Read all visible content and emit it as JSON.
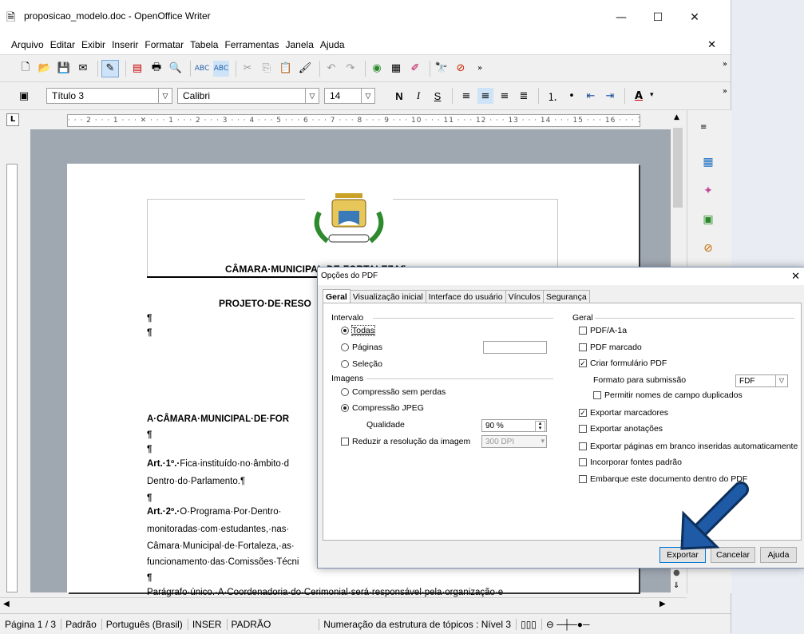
{
  "window": {
    "title": "proposicao_modelo.doc - OpenOffice Writer",
    "controls": [
      "—",
      "☐",
      "✕"
    ]
  },
  "menu": [
    "Arquivo",
    "Editar",
    "Exibir",
    "Inserir",
    "Formatar",
    "Tabela",
    "Ferramentas",
    "Janela",
    "Ajuda"
  ],
  "format_toolbar": {
    "style": "Título 3",
    "font": "Calibri",
    "size": "14",
    "bold": "N",
    "italic": "I",
    "underline": "S"
  },
  "ruler_text": "· · · 2 · · · 1 · · · ✕ · · · 1 · · · 2 · · · 3 · · · 4 · · · 5 · · · 6 · · · 7 · · · 8 · · · 9 · · · 10 · · · 11 · · · 12 · · · 13 · · · 14 · · · 15 · · · 16 · · · 17 · · ·",
  "document": {
    "header_title": "CÂMARA·MUNICIPAL·DE·FORTALEZA¶",
    "project_title": "PROJETO·DE·RESO",
    "para_marks": [
      "¶",
      "¶"
    ],
    "line_camara": "A·CÂMARA·MUNICIPAL·DE·FOR",
    "pm1": "¶",
    "pm2": "¶",
    "art1_label": "Art.·1º.·",
    "art1_text": "Fica·instituído·no·âmbito·d",
    "art1_cont": "Dentro·do·Parlamento.¶",
    "pm3": "¶",
    "art2_label": "Art.·2º.·",
    "art2_text": "O·Programa·Por·Dentro·",
    "art2_l2": "monitoradas·com·estudantes,·nas·",
    "art2_l3": "Câmara·Municipal·de·Fortaleza,·as·",
    "art2_l4": "funcionamento·das·Comissões·Técni",
    "pm4": "¶",
    "paragrafo": "Parágrafo·único.·A·Coordenadoria·do·Cerimonial·será·responsável·pela·organização·e"
  },
  "statusbar": {
    "page": "Página 1 / 3",
    "style": "Padrão",
    "lang": "Português (Brasil)",
    "mode": "INSER",
    "sel": "PADRÃO",
    "outline": "Numeração da estrutura de tópicos : Nível 3"
  },
  "dialog": {
    "title": "Opções do PDF",
    "tabs": [
      "Geral",
      "Visualização inicial",
      "Interface do usuário",
      "Vínculos",
      "Segurança"
    ],
    "intervalo": {
      "label": "Intervalo",
      "todas": "Todas",
      "paginas": "Páginas",
      "selecao": "Seleção"
    },
    "imagens": {
      "label": "Imagens",
      "sem_perdas": "Compressão sem perdas",
      "jpeg": "Compressão JPEG",
      "qualidade_label": "Qualidade",
      "qualidade_value": "90 %",
      "reduzir": "Reduzir a resolução da imagem",
      "dpi": "300 DPI"
    },
    "geral": {
      "label": "Geral",
      "pdfa": "PDF/A-1a",
      "marcado": "PDF marcado",
      "formulario": "Criar formulário PDF",
      "formato_label": "Formato para submissão",
      "formato_value": "FDF",
      "permitir": "Permitir nomes de campo duplicados",
      "marcadores": "Exportar marcadores",
      "anotacoes": "Exportar anotações",
      "paginas_branco": "Exportar páginas em branco inseridas automaticamente",
      "fontes": "Incorporar fontes padrão",
      "embarque": "Embarque este documento dentro do PDF"
    },
    "buttons": {
      "exportar": "Exportar",
      "cancelar": "Cancelar",
      "ajuda": "Ajuda"
    }
  },
  "colors": {
    "arrow": "#1f5aa6",
    "dialog_border": "#7a8fb1"
  }
}
